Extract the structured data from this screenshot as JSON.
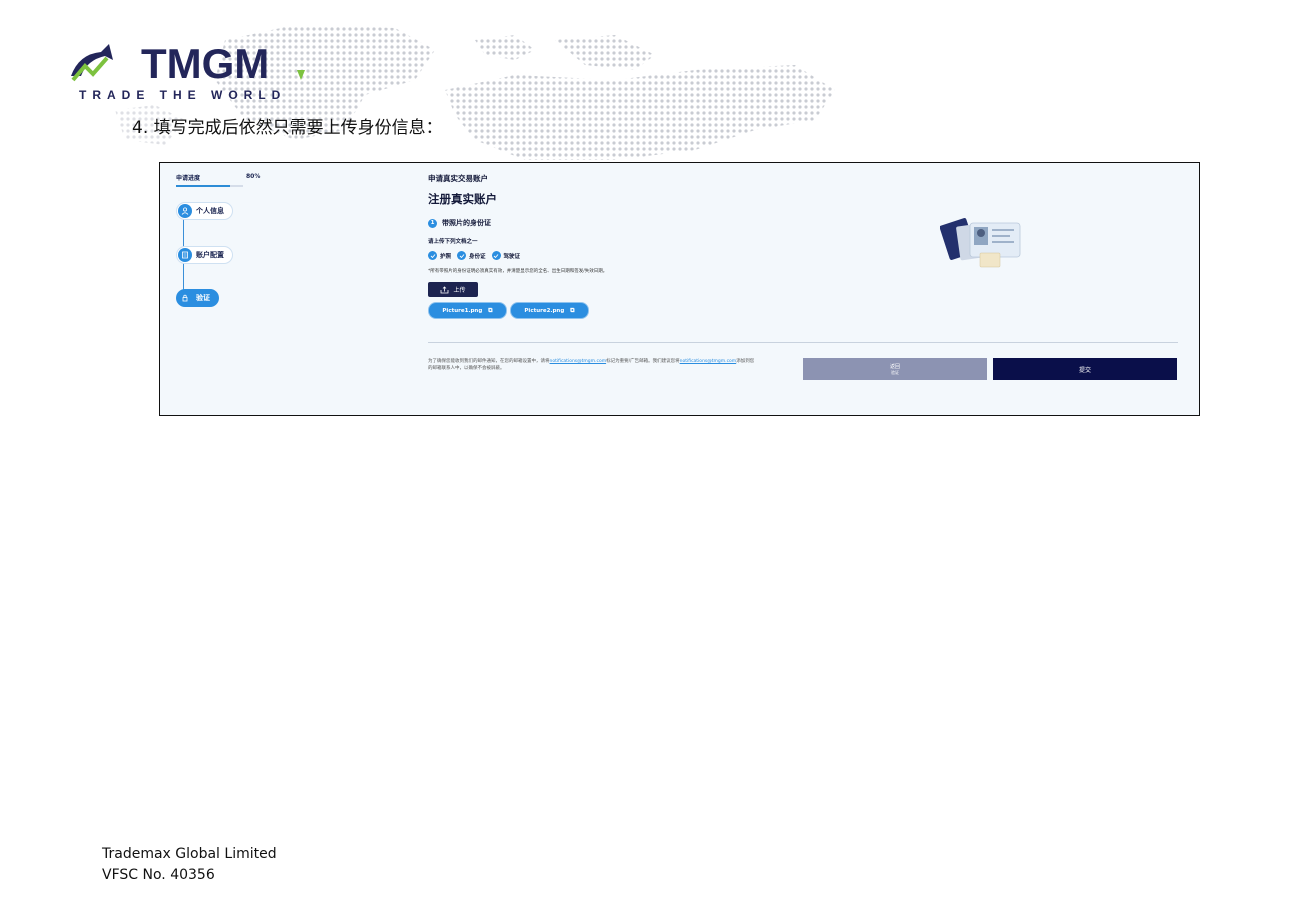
{
  "logo": {
    "brand": "TMGM",
    "tagline": "TRADE THE WORLD"
  },
  "instruction": "4.  填写完成后依然只需要上传身份信息：",
  "screenshot": {
    "progress": {
      "label": "申请进度",
      "percent_text": "80%",
      "value": 0.8
    },
    "steps": [
      {
        "label": "个人信息",
        "icon": "person-icon",
        "active": false
      },
      {
        "label": "账户配置",
        "icon": "account-icon",
        "active": false
      },
      {
        "label": "验证",
        "icon": "lock-icon",
        "active": true
      }
    ],
    "breadcrumb": "申请真实交易账户",
    "heading": "注册真实账户",
    "section": {
      "number": "1",
      "title": "带照片的身份证"
    },
    "hint": "请上传下列文档之一",
    "documents": [
      "护照",
      "身份证",
      "驾驶证"
    ],
    "note": "*所有带照片的身份证明必须真实有效，并清楚显示您的全名、出生日期和签发/失效日期。",
    "upload_label": "上传",
    "files": [
      "Picture1.png",
      "Picture2.png"
    ],
    "footnote_pre": "为了确保您能收到我们的邮件通知，在您的邮箱设置中，请将",
    "footnote_email": "notifications@tmgm.com",
    "footnote_mid": "标记为重要/广告邮箱。我们建议您将",
    "footnote_email2": "notifications@tmgm.com",
    "footnote_post": "添加到您的邮箱联系人中，以确保不会被屏蔽。",
    "back_label": "返回",
    "back_sub": "验证",
    "submit_label": "提交",
    "colors": {
      "accent": "#2b8ee0",
      "navy": "#0a0f4a",
      "back": "#8c93b2"
    }
  },
  "footer": {
    "company": "Trademax Global Limited",
    "license": "VFSC No. 40356"
  }
}
